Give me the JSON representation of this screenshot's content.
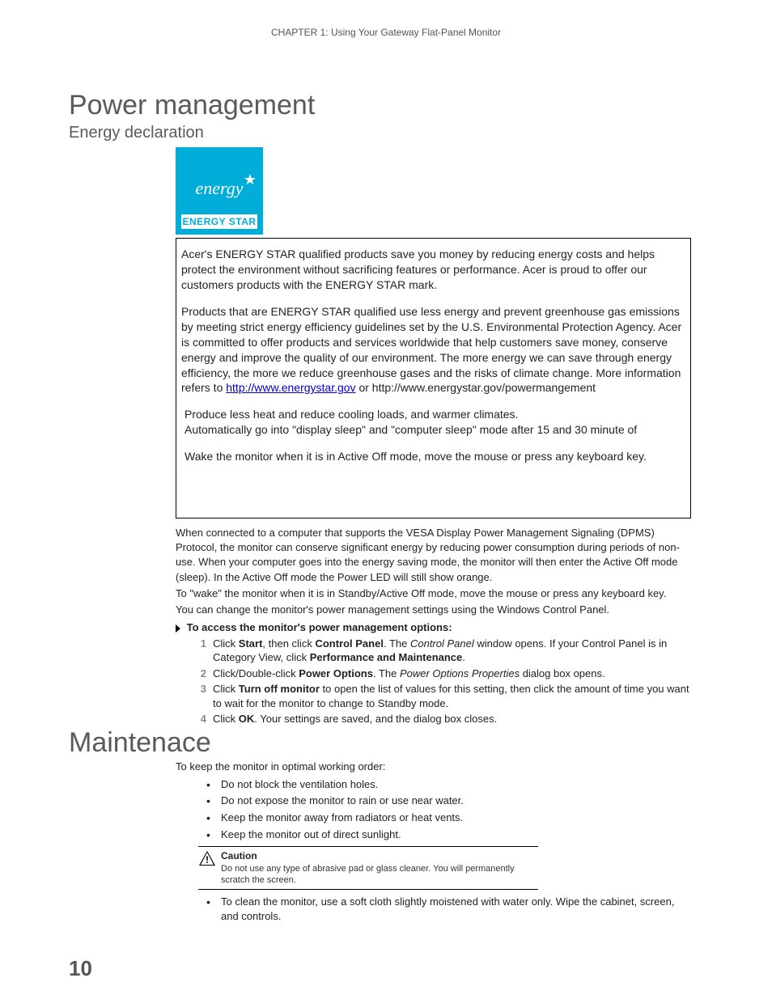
{
  "header": "CHAPTER 1: Using Your Gateway Flat-Panel Monitor",
  "title": "Power management",
  "subtitle": "Energy declaration",
  "energy_star": {
    "script": "energy",
    "band": "ENERGY STAR"
  },
  "box": {
    "p1": "Acer's ENERGY STAR qualified products save you money by reducing energy costs and helps protect the environment without sacrificing features or performance. Acer is proud to offer our customers products with the ENERGY STAR mark.",
    "p2a": "Products that are ENERGY STAR qualified use less energy and prevent greenhouse gas emissions by meeting strict energy efficiency guidelines set by the U.S. Environmental Protection Agency. Acer is committed to offer products and services worldwide that help customers save money, conserve energy and improve the quality of our environment. The more energy we can save through energy efficiency, the more we reduce greenhouse gases and the risks of climate change. More information refers to ",
    "p2_link": "http://www.energystar.gov",
    "p2b": " or http://www.energystar.gov/powermangement",
    "p3": "Produce less heat and reduce cooling loads, and warmer climates.",
    "p4": "Automatically go into \"display sleep\" and \"computer sleep\" mode after 15 and 30 minute of",
    "p5": "Wake the monitor when it is in Active Off mode, move the mouse or press any keyboard key."
  },
  "below": {
    "p1": "When connected to a computer that supports the VESA Display Power Management Signaling (DPMS) Protocol, the monitor can conserve significant energy by reducing power consumption during periods of non-use. When your computer goes into the energy saving mode, the monitor will then enter the Active Off mode (sleep). In the Active Off mode the Power LED will still show orange.",
    "p2": "To \"wake\" the monitor when it is in Standby/Active Off mode, move the mouse or press any keyboard key.",
    "p3": "You can change the monitor's power management settings using the Windows Control Panel."
  },
  "steps_header": "To access the monitor's power management options:",
  "steps": [
    {
      "num": "1",
      "t1": "Click ",
      "b1": "Start",
      "t2": ", then click ",
      "b2": "Control Panel",
      "t3": ". The ",
      "i1": "Control Panel",
      "t4": " window opens. If your Control Panel is in Category View, click ",
      "b3": "Performance and Maintenance",
      "t5": "."
    },
    {
      "num": "2",
      "t1": "Click/Double-click ",
      "b1": "Power Options",
      "t2": ". The ",
      "i1": "Power Options Properties",
      "t3": " dialog box opens."
    },
    {
      "num": "3",
      "t1": "Click ",
      "b1": "Turn off monitor",
      "t2": " to open the list of values for this setting, then click the amount of time you want to wait for the monitor to change to Standby mode."
    },
    {
      "num": "4",
      "t1": "Click ",
      "b1": "OK",
      "t2": ". Your settings are saved, and the dialog box closes."
    }
  ],
  "maintenance_title": "Maintenace",
  "maintenance_intro": "To keep the monitor in optimal working order:",
  "maintenance_bullets": [
    "Do not block the ventilation holes.",
    "Do not expose the monitor to rain or use near water.",
    "Keep the monitor away from radiators or heat vents.",
    "Keep the monitor out of direct sunlight."
  ],
  "caution": {
    "title": "Caution",
    "body": "Do not use any type of abrasive pad or glass cleaner. You will permanently scratch the screen."
  },
  "maintenance_bullets_after": [
    "To clean the monitor, use a soft cloth slightly moistened with water only. Wipe the cabinet, screen, and controls."
  ],
  "page_number": "10"
}
